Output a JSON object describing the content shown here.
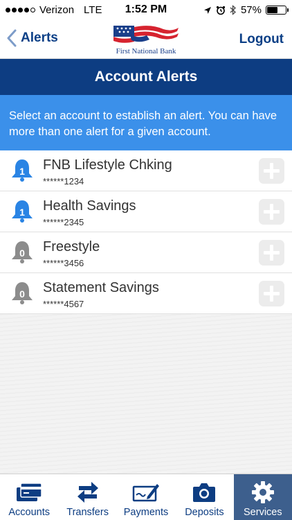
{
  "status_bar": {
    "carrier": "Verizon",
    "network": "LTE",
    "time": "1:52 PM",
    "battery": "57%",
    "battery_level": 0.57
  },
  "nav": {
    "back_label": "Alerts",
    "logout_label": "Logout",
    "logo_text": "First National Bank"
  },
  "header": {
    "title": "Account Alerts"
  },
  "banner": {
    "text": "Select an account to establish an alert. You can have more than one alert for a given account."
  },
  "accounts": [
    {
      "name": "FNB Lifestyle Chking",
      "number": "******1234",
      "alert_count": "1",
      "bell_color": "#2a84e4"
    },
    {
      "name": "Health Savings",
      "number": "******2345",
      "alert_count": "1",
      "bell_color": "#2a84e4"
    },
    {
      "name": "Freestyle",
      "number": "******3456",
      "alert_count": "0",
      "bell_color": "#8c8c8c"
    },
    {
      "name": "Statement Savings",
      "number": "******4567",
      "alert_count": "0",
      "bell_color": "#8c8c8c"
    }
  ],
  "tabs": [
    {
      "label": "Accounts",
      "icon": "credit-card-icon"
    },
    {
      "label": "Transfers",
      "icon": "transfer-arrows-icon"
    },
    {
      "label": "Payments",
      "icon": "check-pen-icon"
    },
    {
      "label": "Deposits",
      "icon": "camera-icon"
    },
    {
      "label": "Services",
      "icon": "gear-icon",
      "active": true
    }
  ],
  "colors": {
    "brand_navy": "#0d3d82",
    "banner_blue": "#3b90ea",
    "active_tab": "#3d5f8d"
  }
}
